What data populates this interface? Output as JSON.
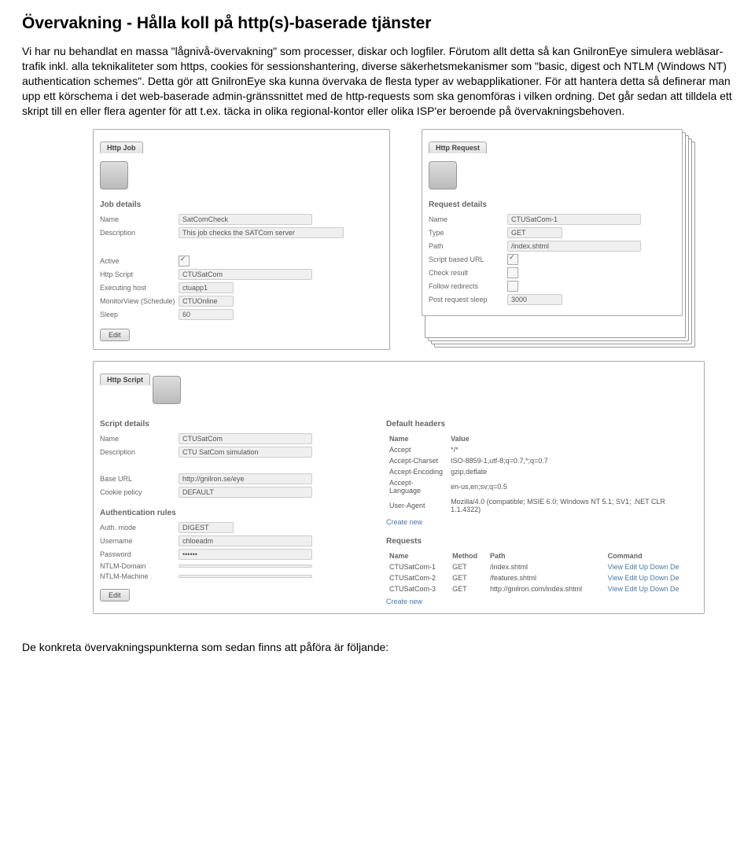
{
  "title": "Övervakning - Hålla koll på http(s)-baserade tjänster",
  "paragraph": "Vi har nu behandlat en massa \"lågnivå-övervakning\" som processer, diskar och logfiler. Förutom allt detta så kan GnilronEye simulera webläsar-trafik inkl. alla teknikaliteter som https, cookies för sessionshantering, diverse säkerhetsmekanismer som \"basic, digest och NTLM (Windows NT) authentication schemes\". Detta gör att GnilronEye ska kunna övervaka de flesta typer av webapplikationer. För att hantera detta så definerar man upp ett körschema i det web-baserade admin-gränssnittet med de http-requests som ska genomföras i vilken ordning. Det går sedan att tilldela ett skript till en eller flera agenter för att t.ex. täcka in olika regional-kontor eller olika ISP'er beroende på övervakningsbehoven.",
  "httpJob": {
    "tab": "Http Job",
    "section": "Job details",
    "name_label": "Name",
    "name": "SatComCheck",
    "description_label": "Description",
    "description": "This job checks the SATCom server",
    "active_label": "Active",
    "httpScript_label": "Http Script",
    "httpScript": "CTUSatCom",
    "execHost_label": "Executing host",
    "execHost": "ctuapp1",
    "monitorView_label": "MonitorView (Schedule)",
    "monitorView": "CTUOnline",
    "sleep_label": "Sleep",
    "sleep": "60",
    "edit": "Edit"
  },
  "httpRequest": {
    "tab": "Http Request",
    "section": "Request details",
    "name_label": "Name",
    "name": "CTUSatCom-1",
    "type_label": "Type",
    "type": "GET",
    "path_label": "Path",
    "path": "/index.shtml",
    "scriptUrl_label": "Script based URL",
    "checkResult_label": "Check result",
    "followRedirects_label": "Follow redirects",
    "postSleep_label": "Post request sleep",
    "postSleep": "3000"
  },
  "httpScript": {
    "tab": "Http Script",
    "scriptDetails": "Script details",
    "name_label": "Name",
    "name": "CTUSatCom",
    "description_label": "Description",
    "description": "CTU SatCom simulation",
    "baseUrl_label": "Base URL",
    "baseUrl": "http://gnilron.se/eye",
    "cookiePolicy_label": "Cookie policy",
    "cookiePolicy": "DEFAULT",
    "authRules": "Authentication rules",
    "authMode_label": "Auth. mode",
    "authMode": "DIGEST",
    "username_label": "Username",
    "username": "chloeadm",
    "password_label": "Password",
    "ntlmDomain_label": "NTLM-Domain",
    "ntlmMachine_label": "NTLM-Machine",
    "defaultHeaders": "Default headers",
    "headers_name": "Name",
    "headers_value": "Value",
    "headers": [
      {
        "n": "Accept",
        "v": "*/*"
      },
      {
        "n": "Accept-Charset",
        "v": "ISO-8859-1,utf-8;q=0.7,*;q=0.7"
      },
      {
        "n": "Accept-Encoding",
        "v": "gzip,deflate"
      },
      {
        "n": "Accept-Language",
        "v": "en-us,en;sv;q=0.5"
      },
      {
        "n": "User-Agent",
        "v": "Mozilla/4.0 (compatible; MSIE 6.0; Windows NT 5.1; SV1; .NET CLR 1.1.4322)"
      }
    ],
    "create_new": "Create new",
    "requests": "Requests",
    "req_name": "Name",
    "req_method": "Method",
    "req_path": "Path",
    "req_command": "Command",
    "req_rows": [
      {
        "n": "CTUSatCom-1",
        "m": "GET",
        "p": "/index.shtml",
        "c": "View Edit Up Down De"
      },
      {
        "n": "CTUSatCom-2",
        "m": "GET",
        "p": "/features.shtml",
        "c": "View Edit Up Down De"
      },
      {
        "n": "CTUSatCom-3",
        "m": "GET",
        "p": "http://gnilron.com/index.shtml",
        "c": "View Edit Up Down De"
      }
    ],
    "edit": "Edit"
  },
  "footer": "De konkreta övervakningspunkterna som sedan finns att påföra är följande:"
}
